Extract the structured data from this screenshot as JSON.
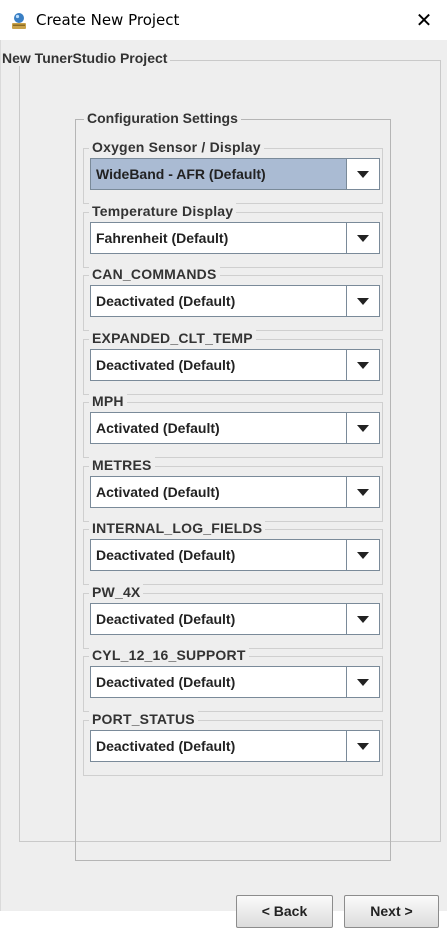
{
  "window": {
    "title": "Create New Project",
    "close_label": "✕"
  },
  "wizard": {
    "outer_title": "New TunerStudio Project",
    "config_title": "Configuration Settings",
    "settings": [
      {
        "label": "Oxygen Sensor / Display",
        "value": "WideBand - AFR (Default)",
        "selected": true
      },
      {
        "label": "Temperature Display",
        "value": "Fahrenheit (Default)"
      },
      {
        "label": "CAN_COMMANDS",
        "value": "Deactivated (Default)"
      },
      {
        "label": "EXPANDED_CLT_TEMP",
        "value": "Deactivated (Default)"
      },
      {
        "label": "MPH",
        "value": "Activated (Default)"
      },
      {
        "label": "METRES",
        "value": "Activated (Default)"
      },
      {
        "label": "INTERNAL_LOG_FIELDS",
        "value": "Deactivated (Default)"
      },
      {
        "label": "PW_4X",
        "value": "Deactivated (Default)"
      },
      {
        "label": "CYL_12_16_SUPPORT",
        "value": "Deactivated (Default)"
      },
      {
        "label": "PORT_STATUS",
        "value": "Deactivated (Default)"
      }
    ]
  },
  "buttons": {
    "back": "< Back",
    "next": "Next >"
  },
  "icons": {
    "app": "tunerstudio-app-icon",
    "close": "close-icon",
    "dropdown": "chevron-down-icon"
  },
  "colors": {
    "selected_combo": "#aabbd3",
    "panel_bg": "#eeeeee"
  }
}
